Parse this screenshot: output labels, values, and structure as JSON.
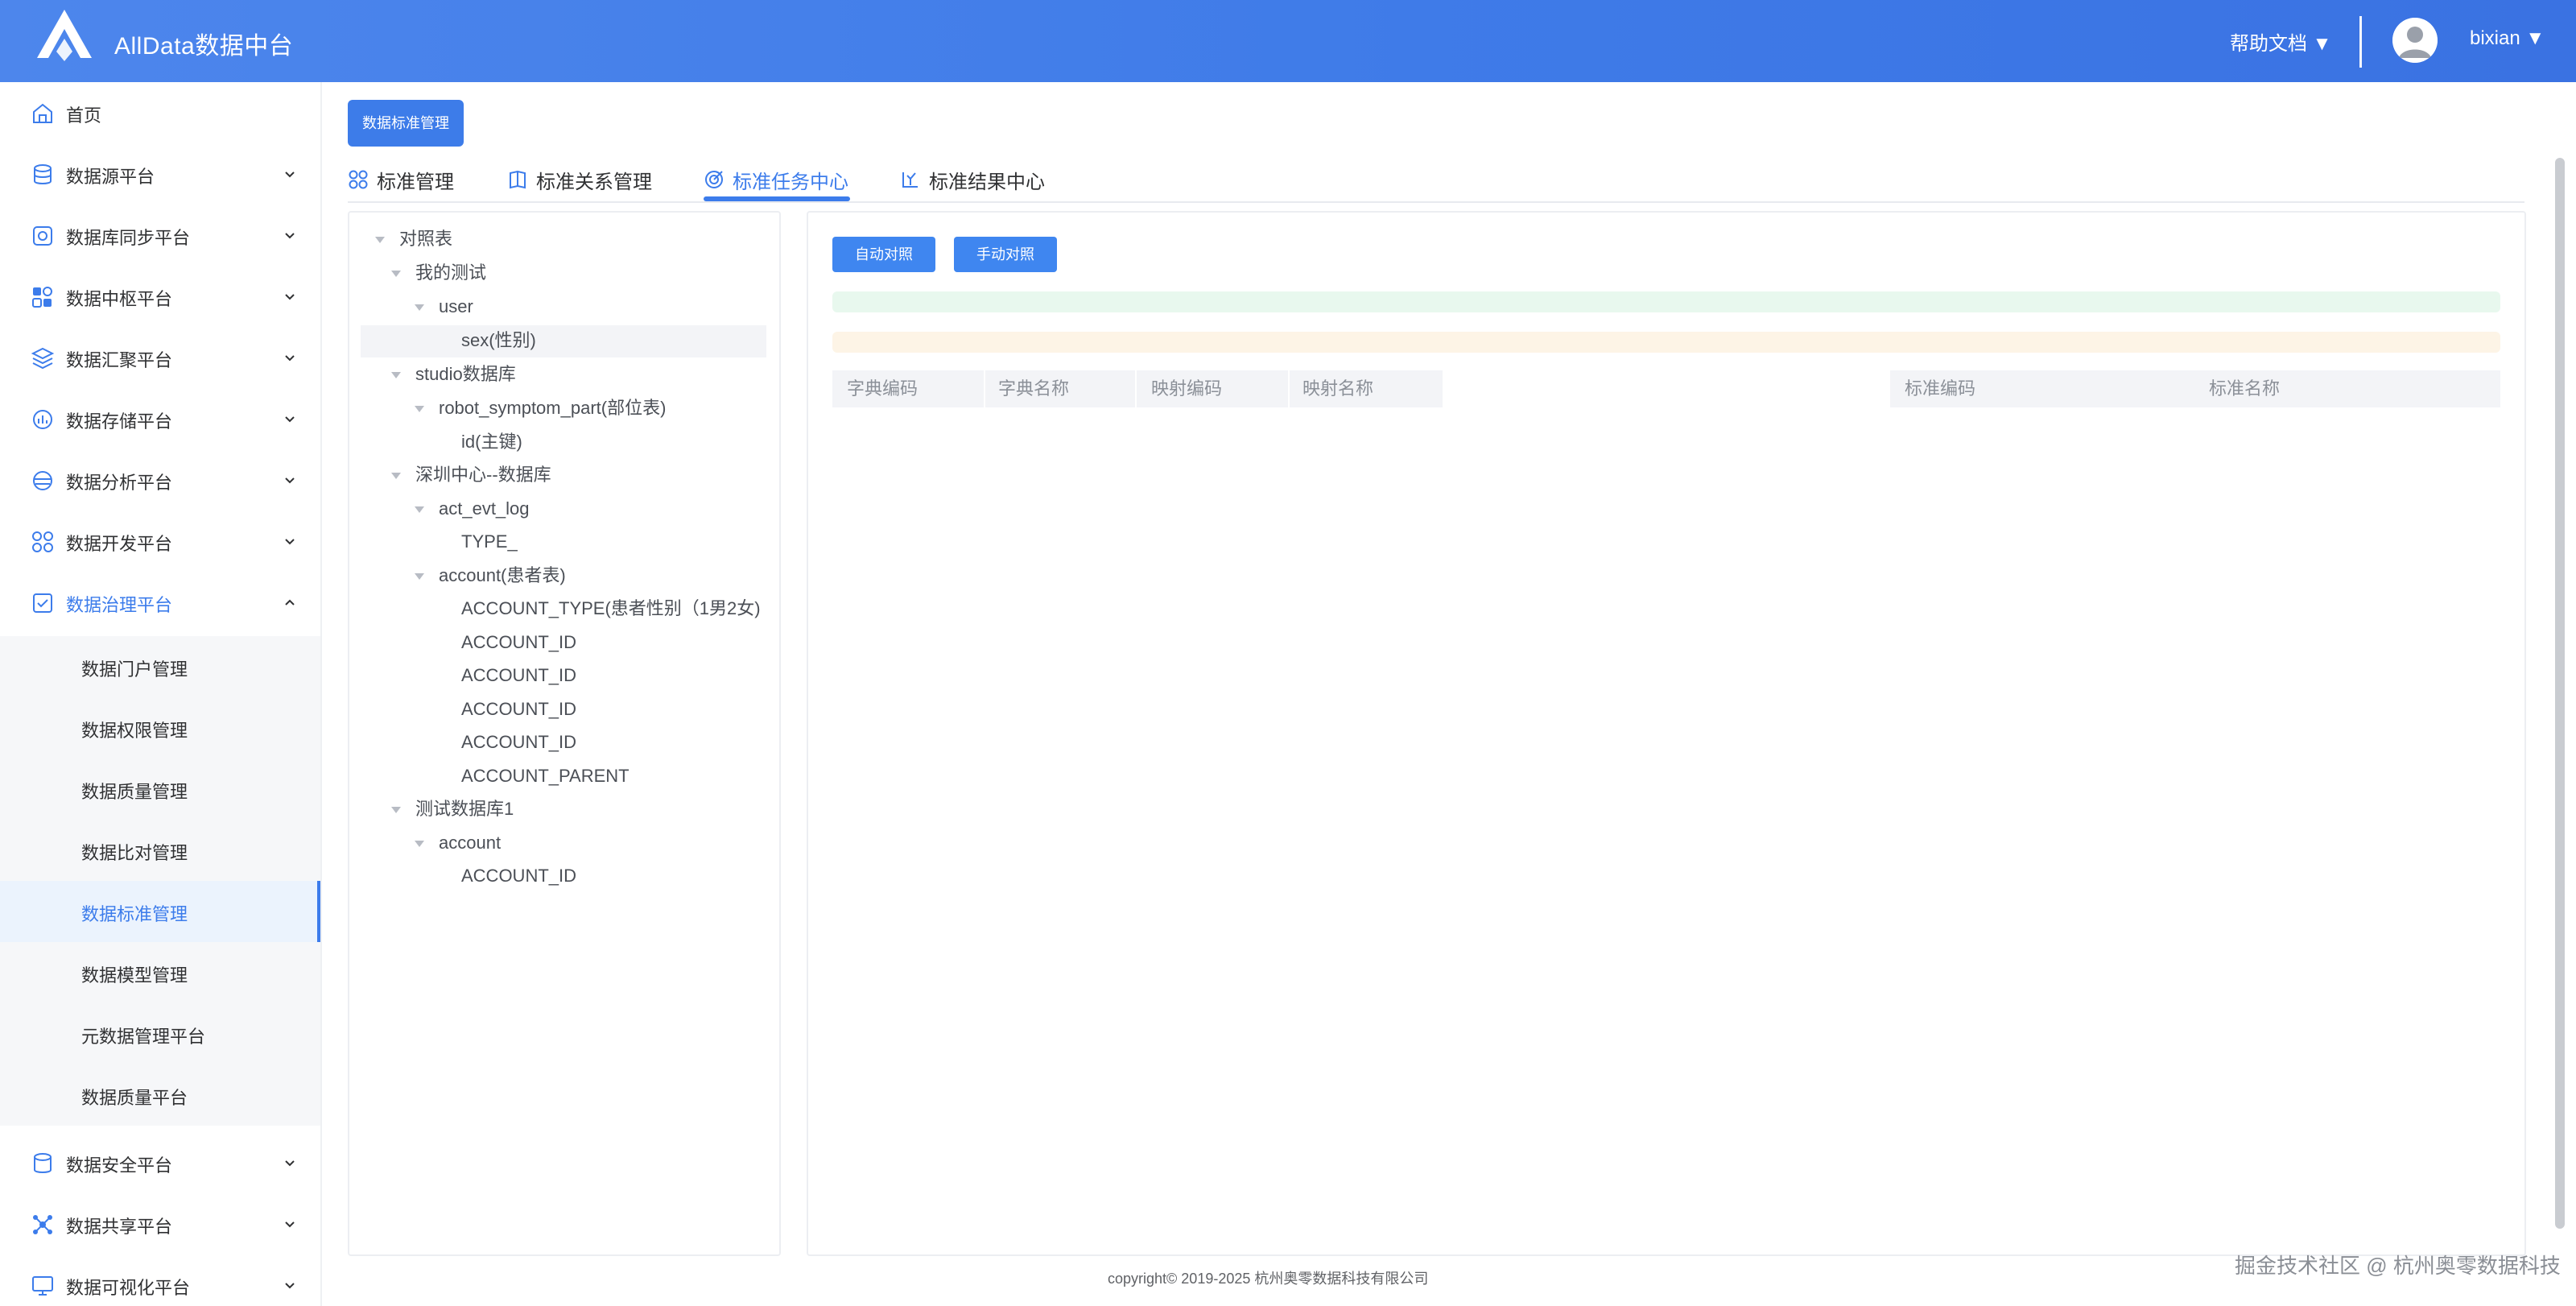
{
  "header": {
    "app_title": "AllData数据中台",
    "help_label": "帮助文档 ▼",
    "user_label": "bixian ▼"
  },
  "sidebar": {
    "items": [
      {
        "label": "首页",
        "icon": "home-icon"
      },
      {
        "label": "数据源平台",
        "icon": "database-icon"
      },
      {
        "label": "数据库同步平台",
        "icon": "sync-icon"
      },
      {
        "label": "数据中枢平台",
        "icon": "grid-icon"
      },
      {
        "label": "数据汇聚平台",
        "icon": "layers-icon"
      },
      {
        "label": "数据存储平台",
        "icon": "storage-chart-icon"
      },
      {
        "label": "数据分析平台",
        "icon": "analysis-icon"
      },
      {
        "label": "数据开发平台",
        "icon": "apps-icon"
      },
      {
        "label": "数据治理平台",
        "icon": "governance-icon"
      }
    ],
    "sub_items": [
      {
        "label": "数据门户管理"
      },
      {
        "label": "数据权限管理"
      },
      {
        "label": "数据质量管理"
      },
      {
        "label": "数据比对管理"
      },
      {
        "label": "数据标准管理"
      },
      {
        "label": "数据模型管理"
      },
      {
        "label": "元数据管理平台"
      },
      {
        "label": "数据质量平台"
      }
    ],
    "bottom_items": [
      {
        "label": "数据安全平台",
        "icon": "security-db-icon"
      },
      {
        "label": "数据共享平台",
        "icon": "share-icon"
      },
      {
        "label": "数据可视化平台",
        "icon": "monitor-icon"
      }
    ]
  },
  "page": {
    "button_label": "数据标准管理",
    "tabs": [
      {
        "label": "标准管理",
        "icon": "apps-icon"
      },
      {
        "label": "标准关系管理",
        "icon": "book-icon"
      },
      {
        "label": "标准任务中心",
        "icon": "target-icon"
      },
      {
        "label": "标准结果中心",
        "icon": "result-icon"
      }
    ],
    "active_tab": "标准任务中心"
  },
  "tree": {
    "nodes": [
      {
        "label": "对照表",
        "level": 0,
        "expanded": true
      },
      {
        "label": "我的测试",
        "level": 1,
        "expanded": true
      },
      {
        "label": "user",
        "level": 2,
        "expanded": true
      },
      {
        "label": "sex(性别)",
        "level": 3,
        "selected": true
      },
      {
        "label": "studio数据库",
        "level": 1,
        "expanded": true
      },
      {
        "label": "robot_symptom_part(部位表)",
        "level": 2,
        "expanded": true
      },
      {
        "label": "id(主键)",
        "level": 3
      },
      {
        "label": "深圳中心--数据库",
        "level": 1,
        "expanded": true
      },
      {
        "label": "act_evt_log",
        "level": 2,
        "expanded": true
      },
      {
        "label": "TYPE_",
        "level": 3
      },
      {
        "label": "account(患者表)",
        "level": 2,
        "expanded": true
      },
      {
        "label": "ACCOUNT_TYPE(患者性别（1男2女)",
        "level": 3
      },
      {
        "label": "ACCOUNT_ID",
        "level": 3
      },
      {
        "label": "ACCOUNT_ID",
        "level": 3
      },
      {
        "label": "ACCOUNT_ID",
        "level": 3
      },
      {
        "label": "ACCOUNT_ID",
        "level": 3
      },
      {
        "label": "ACCOUNT_PARENT",
        "level": 3
      },
      {
        "label": "测试数据库1",
        "level": 1,
        "expanded": true
      },
      {
        "label": "account",
        "level": 2,
        "expanded": true
      },
      {
        "label": "ACCOUNT_ID",
        "level": 3
      }
    ]
  },
  "actions": {
    "auto_label": "自动对照",
    "manual_label": "手动对照"
  },
  "table_left": {
    "headers": [
      "字典编码",
      "字典名称",
      "映射编码",
      "映射名称"
    ]
  },
  "table_right": {
    "headers": [
      "标准编码",
      "标准名称"
    ]
  },
  "footer": {
    "copyright": "copyright© 2019-2025 杭州奥零数据科技有限公司"
  },
  "watermark": {
    "text": "掘金技术社区 @ 杭州奥零数据科技"
  },
  "colors": {
    "primary": "#3c7ceb",
    "header_gradient_start": "#4d86ec",
    "success_bar": "#e8f8ee",
    "warning_bar": "#fdf4e6"
  }
}
